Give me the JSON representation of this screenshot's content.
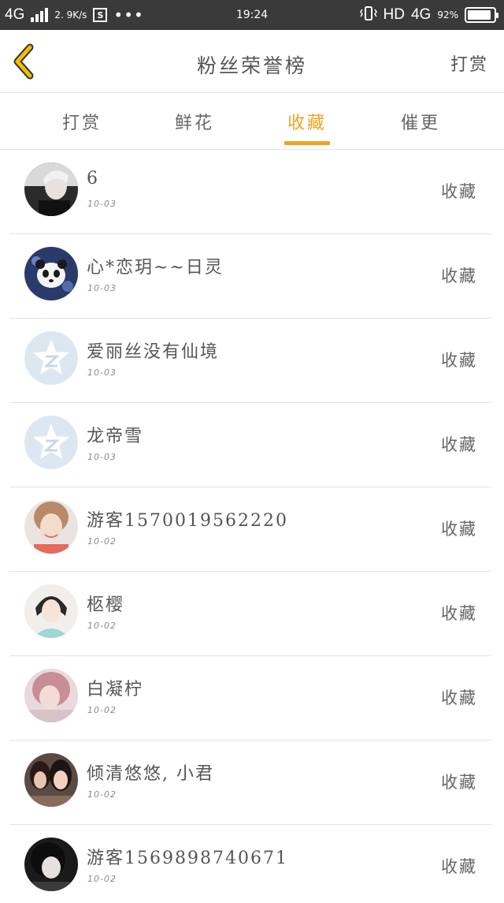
{
  "status_bar": {
    "network_left": "4G",
    "speed": "2. 9K/s",
    "s_badge": "S",
    "more": "•••",
    "time": "19:24",
    "vibrate_icon": "vibrate-icon",
    "hd": "HD",
    "network_right": "4G",
    "battery_pct": "92%",
    "battery_level": 0.92
  },
  "nav": {
    "back_icon": "chevron-left-icon",
    "back_color": "#f0c000",
    "title": "粉丝荣誉榜",
    "right_label": "打赏"
  },
  "tabs": [
    {
      "label": "打赏",
      "active": false
    },
    {
      "label": "鲜花",
      "active": false
    },
    {
      "label": "收藏",
      "active": true
    },
    {
      "label": "催更",
      "active": false
    }
  ],
  "accent_color": "#f0a31f",
  "fans": [
    {
      "name": "6",
      "date": "10-03",
      "action": "收藏",
      "avatar": "photo-avatar"
    },
    {
      "name": "心*恋玥~~日灵",
      "date": "10-03",
      "action": "收藏",
      "avatar": "panda-avatar"
    },
    {
      "name": "爱丽丝没有仙境",
      "date": "10-03",
      "action": "收藏",
      "avatar": "default-qzone-avatar"
    },
    {
      "name": "龙帝雪",
      "date": "10-03",
      "action": "收藏",
      "avatar": "default-qzone-avatar"
    },
    {
      "name": "游客1570019562220",
      "date": "10-02",
      "action": "收藏",
      "avatar": "photo-avatar"
    },
    {
      "name": "柩樱",
      "date": "10-02",
      "action": "收藏",
      "avatar": "photo-avatar"
    },
    {
      "name": "白凝柠",
      "date": "10-02",
      "action": "收藏",
      "avatar": "photo-avatar"
    },
    {
      "name": "倾清悠悠, 小君",
      "date": "10-02",
      "action": "收藏",
      "avatar": "photo-avatar"
    },
    {
      "name": "游客1569898740671",
      "date": "10-02",
      "action": "收藏",
      "avatar": "photo-avatar"
    }
  ]
}
